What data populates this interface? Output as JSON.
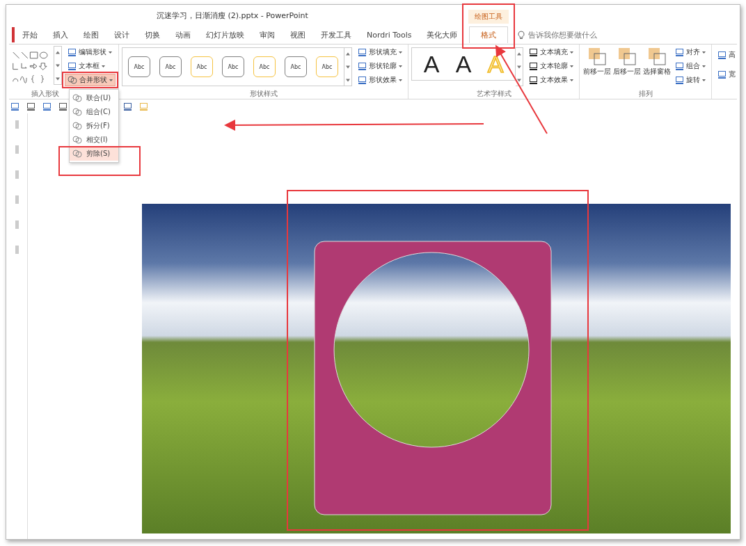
{
  "window": {
    "title": "沉迷学习，日渐消瘦 (2).pptx  -  PowerPoint"
  },
  "contextual_tab_group": "绘图工具",
  "tabs": [
    {
      "label": "开始",
      "selected": false
    },
    {
      "label": "插入",
      "selected": false
    },
    {
      "label": "绘图",
      "selected": false
    },
    {
      "label": "设计",
      "selected": false
    },
    {
      "label": "切换",
      "selected": false
    },
    {
      "label": "动画",
      "selected": false
    },
    {
      "label": "幻灯片放映",
      "selected": false
    },
    {
      "label": "审阅",
      "selected": false
    },
    {
      "label": "视图",
      "selected": false
    },
    {
      "label": "开发工具",
      "selected": false
    },
    {
      "label": "Nordri Tools",
      "selected": false
    },
    {
      "label": "美化大师",
      "selected": false
    },
    {
      "label": "格式",
      "selected": true
    }
  ],
  "tell_me": {
    "placeholder": "告诉我你想要做什么"
  },
  "ribbon": {
    "insert_shapes": {
      "label": "插入形状",
      "buttons": [
        {
          "label": "编辑形状",
          "active": false
        },
        {
          "label": "文本框",
          "active": false
        },
        {
          "label": "合并形状",
          "active": true
        }
      ]
    },
    "shape_styles": {
      "label": "形状样式",
      "swatches": [
        {
          "text": "Abc",
          "color": "#7f7f7f"
        },
        {
          "text": "Abc",
          "color": "#7f7f7f"
        },
        {
          "text": "Abc",
          "color": "#f5c342"
        },
        {
          "text": "Abc",
          "color": "#7f7f7f"
        },
        {
          "text": "Abc",
          "color": "#f5c342"
        },
        {
          "text": "Abc",
          "color": "#7f7f7f"
        },
        {
          "text": "Abc",
          "color": "#f5c342"
        }
      ],
      "commands": [
        "形状填充",
        "形状轮廓",
        "形状效果"
      ]
    },
    "wordart_styles": {
      "label": "艺术字样式",
      "samples": [
        {
          "text": "A",
          "kind": "solid"
        },
        {
          "text": "A",
          "kind": "solid"
        },
        {
          "text": "A",
          "kind": "outline"
        }
      ],
      "commands": [
        "文本填充",
        "文本轮廓",
        "文本效果"
      ]
    },
    "arrange": {
      "label": "排列",
      "large_buttons": [
        "前移一层",
        "后移一层",
        "选择窗格"
      ],
      "commands": [
        "对齐",
        "组合",
        "旋转"
      ]
    },
    "size": {
      "commands": [
        "高",
        "宽"
      ]
    }
  },
  "merge_menu": {
    "items": [
      {
        "label": "联合(U)",
        "selected": false
      },
      {
        "label": "组合(C)",
        "selected": false
      },
      {
        "label": "拆分(F)",
        "selected": false
      },
      {
        "label": "相交(I)",
        "selected": false
      },
      {
        "label": "剪除(S)",
        "selected": true
      }
    ]
  }
}
